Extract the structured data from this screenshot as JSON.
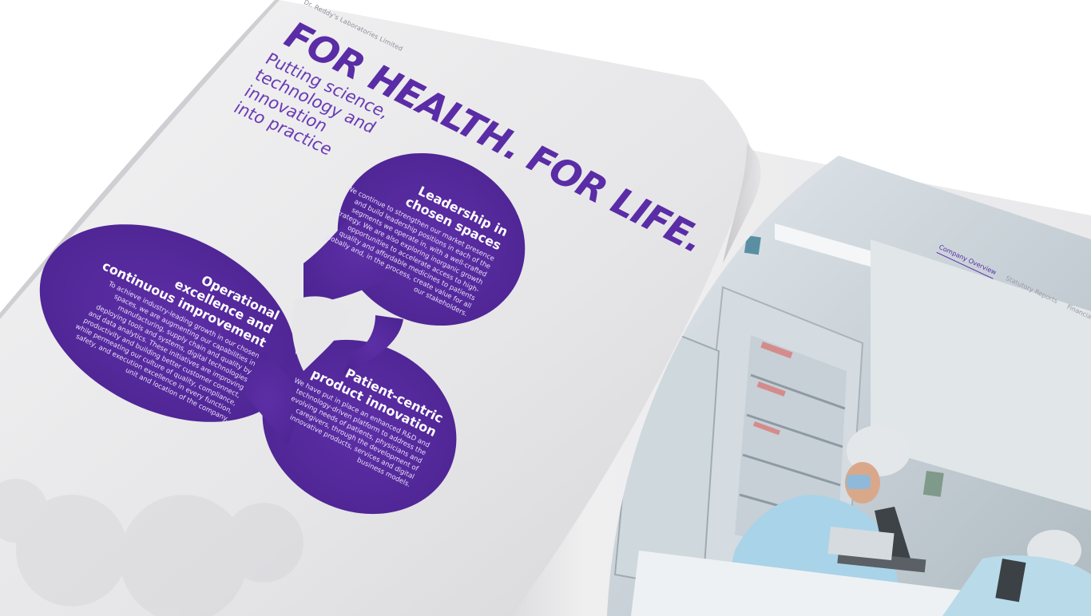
{
  "page": {
    "header": "Dr. Reddy's Laboratories Limited",
    "title": "FOR HEALTH. FOR LIFE.",
    "subtitle_lines": [
      "Putting science,",
      "technology and",
      "innovation",
      "into practice"
    ]
  },
  "lobes": {
    "top": {
      "title_lines": [
        "Leadership in",
        "chosen spaces"
      ],
      "body": "We continue to strengthen our market presence and build leadership positions in each of the segments we operate in, with a well-crafted strategy. We are also exploring inorganic growth opportunities to accelerate access to high-quality and affordable medicines to patients globally and, in the process, create value for all our stakeholders."
    },
    "left": {
      "title_lines": [
        "Operational",
        "excellence and",
        "continuous improvement"
      ],
      "body": "To achieve industry-leading growth in our chosen spaces, we are augmenting our capabilities in manufacturing, supply chain and quality by deploying tools and systems, digital technologies and data analytics. These initiatives are improving productivity and building better customer connect, while permeating our culture of quality, compliance, safety, and execution excellence in every function, unit and location of the company."
    },
    "bottom": {
      "title_lines": [
        "Patient-centric",
        "product innovation"
      ],
      "body": "We have put in place an enhanced R&D and technology-driven platform to address the evolving needs of patients, physicians and caregivers, through the development of innovative products, services and digital business models."
    }
  },
  "right_page": {
    "tabs": [
      "Company Overview",
      "Statutory Reports",
      "Financial Statements"
    ],
    "active_tab": "Company Overview"
  },
  "colors": {
    "brand_purple": "#5a2ca6",
    "lobe_purple": "#56299b",
    "page_grey": "#e9e9ea"
  }
}
